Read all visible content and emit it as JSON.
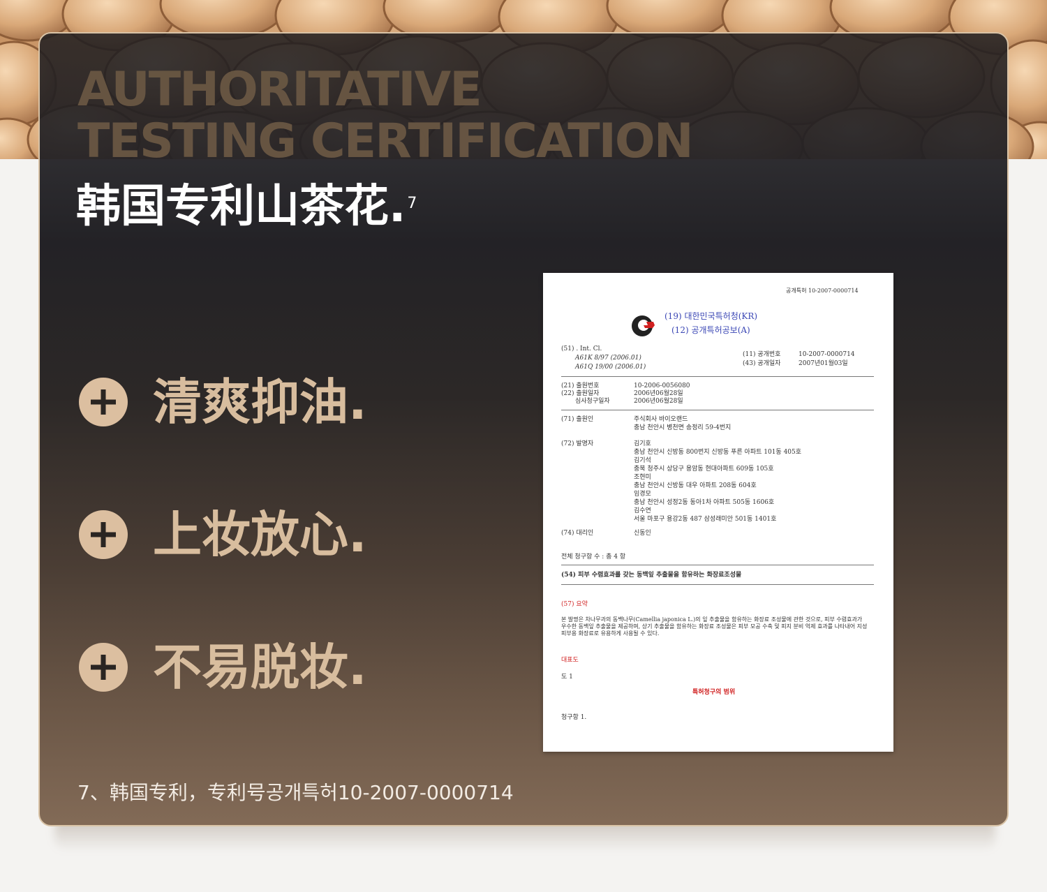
{
  "hero": {
    "bg_heading_line1": "AUTHORITATIVE",
    "bg_heading_line2": "TESTING CERTIFICATION",
    "title": "韩国专利山茶花.",
    "title_sup": "7"
  },
  "features": [
    {
      "label": "清爽抑油.",
      "icon": "plus-icon"
    },
    {
      "label": "上妆放心.",
      "icon": "plus-icon"
    },
    {
      "label": "不易脱妆.",
      "icon": "plus-icon"
    }
  ],
  "footnote": "7、韩国专利，专利号공개특허10-2007-0000714",
  "patent_document": {
    "top_right_number": "공개특허 10-2007-0000714",
    "office_line": "(19) 대한민국특허청(KR)",
    "publication_line": "(12) 공개특허공보(A)",
    "int_cl": "(51) . Int. Cl.",
    "cl_1": "A61K 8/97 (2006.01)",
    "cl_2": "A61Q 19/00 (2006.01)",
    "pub_no_label": "(11) 공개번호",
    "pub_no_value": "10-2007-0000714",
    "pub_date_label": "(43) 공개일자",
    "pub_date_value": "2007년01월03일",
    "app_no_label": "(21) 출원번호",
    "app_no_value": "10-2006-0056080",
    "app_date_label": "(22) 출원일자",
    "app_date_value": "2006년06월28일",
    "exam_label": "심사청구일자",
    "exam_value": "2006년06월28일",
    "applicant_label": "(71) 출원인",
    "applicant_line1": "주식회사 바이오랜드",
    "applicant_line2": "충남 천안시 병천면 송정리 59-4번지",
    "inventor_label": "(72) 발명자",
    "inventor_lines": [
      "김기호",
      "충남 천안시 신방동 800번지 신방동 푸른 아파트 101동 405호",
      "김기석",
      "충북 청주시 상당구 용암동 현대아파트 609동 105호",
      "조현미",
      "충남 천안시 신방동 대우 아파트 208동 604호",
      "임경모",
      "충남 천안시 성정2동 동아1차 아파트 505동 1606호",
      "김수연",
      "서울 마포구 용강2동 487 삼성래미안 501동 1401호"
    ],
    "agent_label": "(74) 대리인",
    "agent_value": "신동인",
    "claims_count": "전체 청구항 수 : 총 4 항",
    "invention_title": "(54) 피부 수렴효과를 갖는 동백잎 추출물을 함유하는 화장료조성물",
    "abstract_label": "(57) 요약",
    "abstract_text": "본 발명은 차나무과의 동백나무(Camellia japonica L.)의 잎 추출물을 함유하는 화장료 조성물에 관한 것으로, 피부 수렴효과가 우수한 동백잎 추출물을 제공하며, 상기 추출물을 함유하는 화장료 조성물은 피부 모공 수축 및 피지 분비 억제 효과를 나타내어 지성 피부용 화장료로 유용하게 사용될 수 있다.",
    "rep_fig_label": "대표도",
    "fig_label": "도 1",
    "claims_label": "특허청구의 범위",
    "claim1_label": "청구항 1."
  },
  "colors": {
    "feature_text": "#d8bd9e",
    "icon_fill": "#dcbfa0",
    "title_text": "#ffffff",
    "bg_heading_text": "#6b5844"
  }
}
